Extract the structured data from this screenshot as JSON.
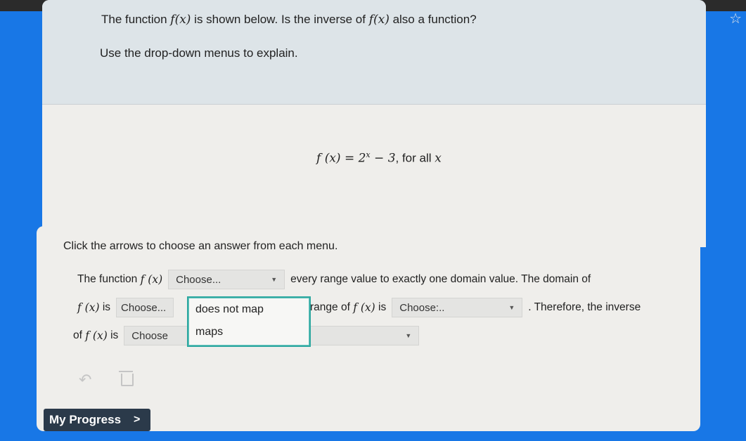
{
  "question": {
    "line1_pre": "The function ",
    "fx": "f(x)",
    "line1_mid": " is shown below. Is the inverse of ",
    "line1_post": " also a function?",
    "line2": "Use the drop-down menus to explain.",
    "equation": "f (x) = 2",
    "eq_exp": "x",
    "eq_tail": " − 3",
    "eq_suffix": ", for all ",
    "eq_var": "x"
  },
  "answer": {
    "instructions": "Click the arrows to choose an answer from each menu.",
    "row1_pre": "The function",
    "row1_fx": "f (x)",
    "row1_post": "every range value to exactly one domain value. The domain of",
    "row2_fx": "f (x)",
    "row2_is": "is",
    "row2_mid_pre": "range of",
    "row2_mid_fx": "f (x)",
    "row2_mid_is": "is",
    "row2_post": ". Therefore, the inverse",
    "row3_pre": "of",
    "row3_fx": "f (x)",
    "row3_is": "is",
    "select1": "Choose...",
    "select2": "Choose...",
    "select3": "Choose:..",
    "select4": "Choose",
    "dropdown_options": [
      "does not map",
      "maps"
    ]
  },
  "footer": {
    "progress_label": "My Progress",
    "progress_chevron": ">"
  },
  "icons": {
    "undo": "undo-icon",
    "trash": "trash-icon",
    "star": "bookmark-star-icon"
  }
}
